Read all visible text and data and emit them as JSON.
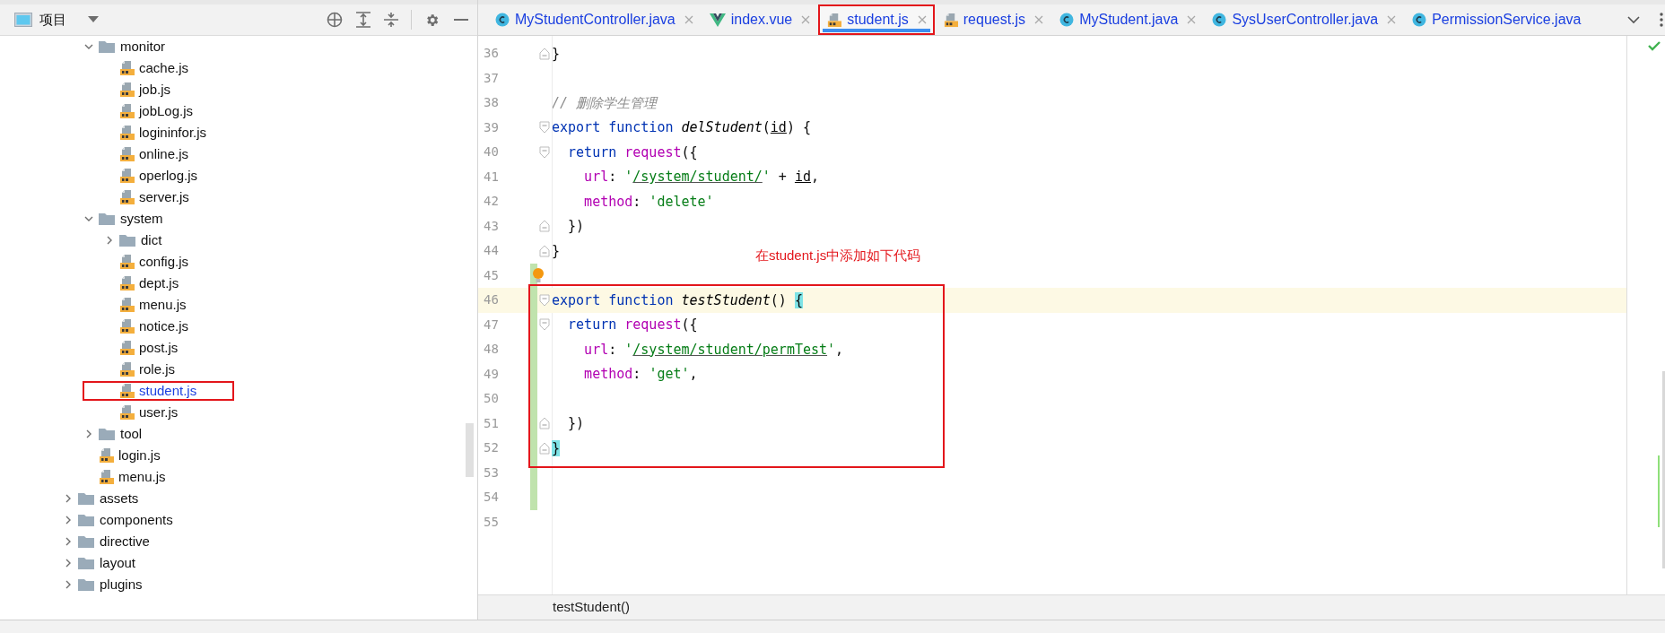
{
  "project_panel": {
    "title": "项目"
  },
  "tree": {
    "nested_items": [
      {
        "name": "monitor",
        "kind": "folder",
        "expanded": true,
        "children": [
          {
            "name": "cache.js",
            "kind": "file",
            "modified": false,
            "annotated": false
          },
          {
            "name": "job.js",
            "kind": "file",
            "modified": false,
            "annotated": false
          },
          {
            "name": "jobLog.js",
            "kind": "file",
            "modified": false,
            "annotated": false
          },
          {
            "name": "logininfor.js",
            "kind": "file",
            "modified": false,
            "annotated": false
          },
          {
            "name": "online.js",
            "kind": "file",
            "modified": false,
            "annotated": false
          },
          {
            "name": "operlog.js",
            "kind": "file",
            "modified": false,
            "annotated": false
          },
          {
            "name": "server.js",
            "kind": "file",
            "modified": false,
            "annotated": false
          }
        ]
      },
      {
        "name": "system",
        "kind": "folder",
        "expanded": true,
        "children": [
          {
            "name": "dict",
            "kind": "folder",
            "expanded": false
          },
          {
            "name": "config.js",
            "kind": "file",
            "modified": false,
            "annotated": false
          },
          {
            "name": "dept.js",
            "kind": "file",
            "modified": false,
            "annotated": false
          },
          {
            "name": "menu.js",
            "kind": "file",
            "modified": false,
            "annotated": false
          },
          {
            "name": "notice.js",
            "kind": "file",
            "modified": false,
            "annotated": false
          },
          {
            "name": "post.js",
            "kind": "file",
            "modified": false,
            "annotated": false
          },
          {
            "name": "role.js",
            "kind": "file",
            "modified": false,
            "annotated": false
          },
          {
            "name": "student.js",
            "kind": "file",
            "modified": true,
            "annotated": true
          },
          {
            "name": "user.js",
            "kind": "file",
            "modified": false,
            "annotated": false
          }
        ]
      },
      {
        "name": "tool",
        "kind": "folder",
        "expanded": false
      },
      {
        "name": "login.js",
        "kind": "file",
        "modified": false,
        "annotated": false
      },
      {
        "name": "menu.js",
        "kind": "file",
        "modified": false,
        "annotated": false
      }
    ],
    "items": [
      {
        "name": "assets",
        "kind": "folder",
        "expanded": false
      },
      {
        "name": "components",
        "kind": "folder",
        "expanded": false
      },
      {
        "name": "directive",
        "kind": "folder",
        "expanded": false
      },
      {
        "name": "layout",
        "kind": "folder",
        "expanded": false
      },
      {
        "name": "plugins",
        "kind": "folder",
        "expanded": false
      }
    ]
  },
  "tabs": [
    {
      "label": "MyStudentController.java",
      "kind": "java",
      "selected": false,
      "closable": true,
      "annotated": false
    },
    {
      "label": "index.vue",
      "kind": "vue",
      "selected": false,
      "closable": true,
      "annotated": false
    },
    {
      "label": "student.js",
      "kind": "js",
      "selected": true,
      "closable": true,
      "annotated": true
    },
    {
      "label": "request.js",
      "kind": "js",
      "selected": false,
      "closable": true,
      "annotated": false
    },
    {
      "label": "MyStudent.java",
      "kind": "java",
      "selected": false,
      "closable": true,
      "annotated": false
    },
    {
      "label": "SysUserController.java",
      "kind": "java",
      "selected": false,
      "closable": true,
      "annotated": false
    },
    {
      "label": "PermissionService.java",
      "kind": "java",
      "selected": false,
      "closable": false,
      "annotated": false
    }
  ],
  "editor": {
    "lines": [
      {
        "number": "36",
        "fold_start": false,
        "fold_end": true,
        "changed": false,
        "current": false,
        "annotated": false,
        "bulb": false,
        "tokens": [
          {
            "text": "}",
            "kind": "punc"
          }
        ]
      },
      {
        "number": "37",
        "fold_start": false,
        "fold_end": false,
        "changed": false,
        "current": false,
        "annotated": false,
        "bulb": false
      },
      {
        "number": "38",
        "fold_start": false,
        "fold_end": false,
        "changed": false,
        "current": false,
        "annotated": false,
        "bulb": false,
        "tokens": [
          {
            "text": "// 删除学生管理",
            "kind": "comment"
          }
        ]
      },
      {
        "number": "39",
        "fold_start": true,
        "fold_end": false,
        "changed": false,
        "current": false,
        "annotated": false,
        "bulb": false,
        "tokens": [
          {
            "text": "export function ",
            "kind": "keyword"
          },
          {
            "text": "delStudent",
            "kind": "fn"
          },
          {
            "text": "(",
            "kind": "punc"
          },
          {
            "text": "id",
            "kind": "param"
          },
          {
            "text": ") {",
            "kind": "punc"
          }
        ]
      },
      {
        "number": "40",
        "fold_start": true,
        "fold_end": false,
        "changed": false,
        "current": false,
        "annotated": false,
        "bulb": false,
        "tokens": [
          {
            "text": "  return ",
            "kind": "keyword"
          },
          {
            "text": "request",
            "kind": "prop"
          },
          {
            "text": "({",
            "kind": "punc"
          }
        ]
      },
      {
        "number": "41",
        "fold_start": false,
        "fold_end": false,
        "changed": false,
        "current": false,
        "annotated": false,
        "bulb": false,
        "tokens": [
          {
            "text": "    url",
            "kind": "prop"
          },
          {
            "text": ": ",
            "kind": "punc"
          },
          {
            "text": "'",
            "kind": "string"
          },
          {
            "text": "/system/student/",
            "kind": "link"
          },
          {
            "text": "'",
            "kind": "string"
          },
          {
            "text": " + ",
            "kind": "punc"
          },
          {
            "text": "id",
            "kind": "param"
          },
          {
            "text": ",",
            "kind": "punc"
          }
        ]
      },
      {
        "number": "42",
        "fold_start": false,
        "fold_end": false,
        "changed": false,
        "current": false,
        "annotated": false,
        "bulb": false,
        "tokens": [
          {
            "text": "    method",
            "kind": "prop"
          },
          {
            "text": ": ",
            "kind": "punc"
          },
          {
            "text": "'delete'",
            "kind": "string"
          }
        ]
      },
      {
        "number": "43",
        "fold_start": false,
        "fold_end": true,
        "changed": false,
        "current": false,
        "annotated": false,
        "bulb": false,
        "tokens": [
          {
            "text": "  })",
            "kind": "punc"
          }
        ]
      },
      {
        "number": "44",
        "fold_start": false,
        "fold_end": true,
        "changed": false,
        "current": false,
        "annotated": false,
        "bulb": false,
        "tokens": [
          {
            "text": "}",
            "kind": "punc"
          }
        ]
      },
      {
        "number": "45",
        "fold_start": false,
        "fold_end": false,
        "changed": true,
        "current": false,
        "annotated": false,
        "bulb": true
      },
      {
        "number": "46",
        "fold_start": true,
        "fold_end": false,
        "changed": true,
        "current": true,
        "annotated": true,
        "bulb": false,
        "tokens": [
          {
            "text": "export function ",
            "kind": "keyword"
          },
          {
            "text": "testStudent",
            "kind": "fn"
          },
          {
            "text": "() ",
            "kind": "punc"
          },
          {
            "text": "{",
            "kind": "match"
          }
        ]
      },
      {
        "number": "47",
        "fold_start": true,
        "fold_end": false,
        "changed": true,
        "current": false,
        "annotated": true,
        "bulb": false,
        "tokens": [
          {
            "text": "  return ",
            "kind": "keyword"
          },
          {
            "text": "request",
            "kind": "prop"
          },
          {
            "text": "({",
            "kind": "punc"
          }
        ]
      },
      {
        "number": "48",
        "fold_start": false,
        "fold_end": false,
        "changed": true,
        "current": false,
        "annotated": true,
        "bulb": false,
        "tokens": [
          {
            "text": "    url",
            "kind": "prop"
          },
          {
            "text": ": ",
            "kind": "punc"
          },
          {
            "text": "'",
            "kind": "string"
          },
          {
            "text": "/system/student/permTest",
            "kind": "link"
          },
          {
            "text": "'",
            "kind": "string"
          },
          {
            "text": ",",
            "kind": "punc"
          }
        ]
      },
      {
        "number": "49",
        "fold_start": false,
        "fold_end": false,
        "changed": true,
        "current": false,
        "annotated": true,
        "bulb": false,
        "tokens": [
          {
            "text": "    method",
            "kind": "prop"
          },
          {
            "text": ": ",
            "kind": "punc"
          },
          {
            "text": "'get'",
            "kind": "string"
          },
          {
            "text": ",",
            "kind": "punc"
          }
        ]
      },
      {
        "number": "50",
        "fold_start": false,
        "fold_end": false,
        "changed": true,
        "current": false,
        "annotated": true,
        "bulb": false
      },
      {
        "number": "51",
        "fold_start": false,
        "fold_end": true,
        "changed": true,
        "current": false,
        "annotated": true,
        "bulb": false,
        "tokens": [
          {
            "text": "  })",
            "kind": "punc"
          }
        ]
      },
      {
        "number": "52",
        "fold_start": false,
        "fold_end": true,
        "changed": true,
        "current": false,
        "annotated": true,
        "bulb": false,
        "tokens": [
          {
            "text": "}",
            "kind": "match"
          }
        ]
      },
      {
        "number": "53",
        "fold_start": false,
        "fold_end": false,
        "changed": true,
        "current": false,
        "annotated": false,
        "bulb": false
      },
      {
        "number": "54",
        "fold_start": false,
        "fold_end": false,
        "changed": true,
        "current": false,
        "annotated": false,
        "bulb": false
      },
      {
        "number": "55",
        "fold_start": false,
        "fold_end": false,
        "changed": false,
        "current": false,
        "annotated": false,
        "bulb": false
      }
    ],
    "annotation": "在student.js中添加如下代码",
    "breadcrumb": "testStudent()"
  }
}
